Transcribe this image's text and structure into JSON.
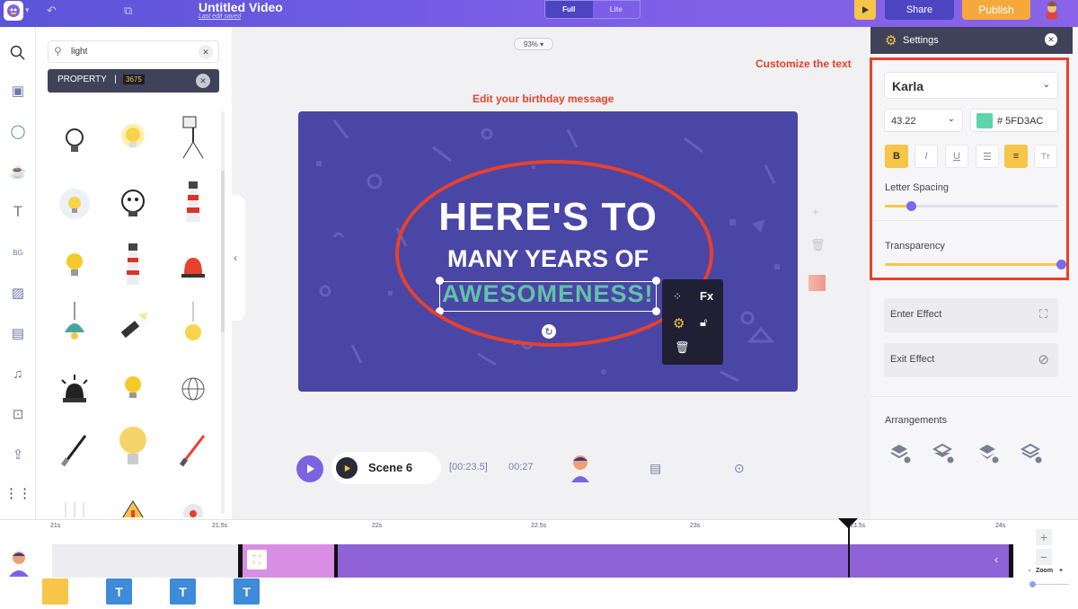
{
  "header": {
    "title": "Untitled Video",
    "subtitle": "Last edit saved",
    "modes": [
      "Full",
      "Lite"
    ],
    "share_label": "Share",
    "publish_label": "Publish"
  },
  "library": {
    "search_value": "light",
    "property_label": "PROPERTY",
    "property_sep": "|",
    "property_code": "3675",
    "icons": [
      "lightbulb-outline-icon",
      "lightbulb-glow-icon",
      "studio-light-icon",
      "lightbulb-idea-icon",
      "lightbulb-face-icon",
      "lighthouse-icon",
      "lightbulb-icon",
      "lighthouse-icon",
      "siren-icon",
      "pendant-lamp-icon",
      "flashlight-icon",
      "hanging-bulb-icon",
      "alarm-light-icon",
      "lightbulb-icon",
      "disco-ball-icon",
      "lightsaber-icon",
      "lightbulb-large-icon",
      "lightsaber-red-icon",
      "string-lights-icon",
      "traffic-sign-icon",
      "bulb-round-icon"
    ]
  },
  "canvas": {
    "zoom": "93% ▾",
    "annotation_left": "Edit your birthday message",
    "line1": "HERE'S TO",
    "line2": "MANY YEARS OF",
    "line3": "AWESOMENESS!",
    "fx_label": "Fx"
  },
  "player": {
    "scene_label": "Scene 6",
    "time_range": "[00:23.5]",
    "time_total": "00:27"
  },
  "settings": {
    "header": "Settings",
    "annotation_right": "Customize the text",
    "font": "Karla",
    "size": "43.22",
    "color_hex": "# 5FD3AC",
    "color_swatch": "#5fd3ac",
    "letter_spacing_label": "Letter Spacing",
    "letter_spacing_value": 0.15,
    "transparency_label": "Transparency",
    "transparency_value": 1.0,
    "enter_effect": "Enter Effect",
    "exit_effect": "Exit Effect",
    "arrangements_label": "Arrangements"
  },
  "timeline": {
    "ticks": [
      "21s",
      "21.5s",
      "22s",
      "22.5s",
      "23s",
      "23.5s",
      "24s"
    ],
    "zoom_label": "Zoom",
    "zoom_minus": "-",
    "zoom_plus": "+",
    "chip_label": "T"
  },
  "colors": {
    "accent": "#7c63e0",
    "annotation": "#e8412c",
    "yellow": "#f7c548",
    "canvas_bg": "#4a46a6"
  }
}
